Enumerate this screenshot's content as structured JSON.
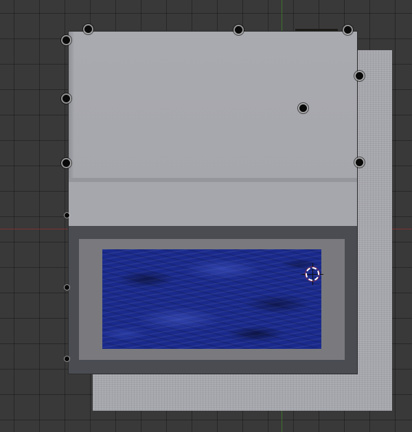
{
  "viewport": {
    "background_color": "#393939",
    "grid_color": "#2e2e2e",
    "axis_x_color": "#8a3030",
    "axis_y_color": "#3f7d2c"
  },
  "scene": {
    "model_top_color": "#a9aaaf",
    "model_side_color": "#4a4c52",
    "inner_frame_color": "#7a7a7e",
    "water_texture_color": "#1a2a8c",
    "ground_plane_color": "#a5a6ac",
    "vertex_icon": "vertex-dot-icon",
    "cursor_icon": "3d-cursor-icon"
  }
}
